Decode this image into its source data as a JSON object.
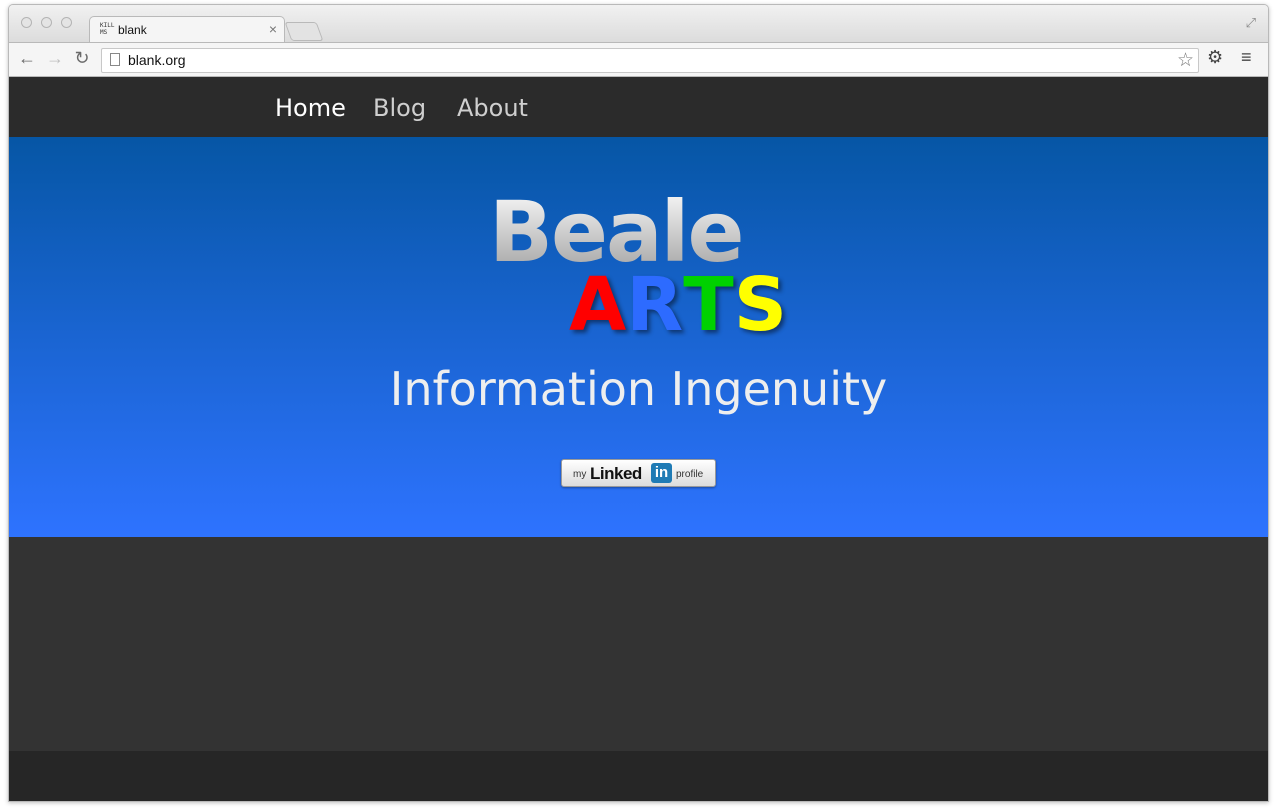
{
  "browser": {
    "tab": {
      "title": "blank",
      "favicon_text": "KILL MS"
    },
    "url": "blank.org"
  },
  "nav": {
    "items": [
      {
        "label": "Home",
        "active": true
      },
      {
        "label": "Blog",
        "active": false
      },
      {
        "label": "About",
        "active": false
      }
    ]
  },
  "hero": {
    "logo_text": "Beale",
    "logo_arts": [
      {
        "char": "A",
        "color": "#ff0000"
      },
      {
        "char": "R",
        "color": "#2d6bff"
      },
      {
        "char": "T",
        "color": "#00d100"
      },
      {
        "char": "S",
        "color": "#ffff00"
      }
    ],
    "tagline": "Information Ingenuity",
    "linkedin": {
      "prefix": "my",
      "linked": "Linked",
      "in": "in",
      "suffix": "profile"
    }
  },
  "colors": {
    "navbar": "#2b2b2b",
    "hero_top": "#0656a5",
    "hero_bottom": "#2e73ff",
    "page_bg": "#333333"
  }
}
